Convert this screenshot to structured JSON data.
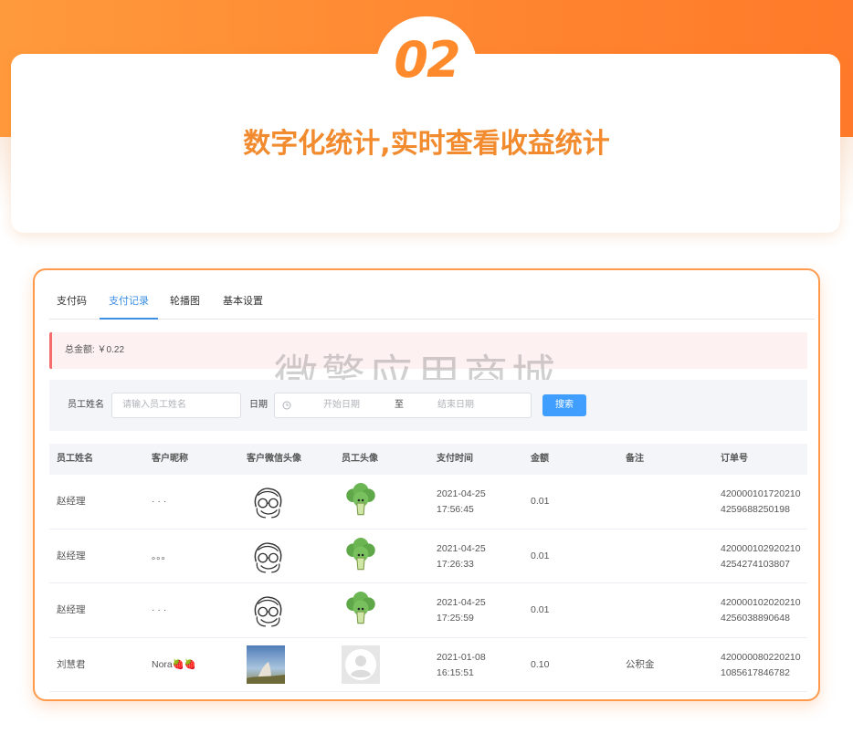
{
  "hero": {
    "badge_number": "02",
    "title": "数字化统计,实时查看收益统计"
  },
  "tabs": [
    {
      "label": "支付码",
      "active": false
    },
    {
      "label": "支付记录",
      "active": true
    },
    {
      "label": "轮播图",
      "active": false
    },
    {
      "label": "基本设置",
      "active": false
    }
  ],
  "summary": {
    "total_label": "总金额: ￥0.22"
  },
  "watermark": "微擎应用商城",
  "search": {
    "employee_label": "员工姓名",
    "employee_placeholder": "请输入员工姓名",
    "date_label": "日期",
    "start_placeholder": "开始日期",
    "range_separator": "至",
    "end_placeholder": "结束日期",
    "button_label": "搜索"
  },
  "table": {
    "headers": [
      "员工姓名",
      "客户昵称",
      "客户微信头像",
      "员工头像",
      "支付时间",
      "金额",
      "备注",
      "订单号"
    ],
    "rows": [
      {
        "employee": "赵经理",
        "nickname": "· · ·",
        "customer_avatar": "sketch-avatar-icon",
        "employee_avatar": "broccoli-icon",
        "time_date": "2021-04-25",
        "time_clock": "17:56:45",
        "amount": "0.01",
        "note": "",
        "order_1": "420000101720210",
        "order_2": "4259688250198"
      },
      {
        "employee": "赵经理",
        "nickname": "。。。",
        "customer_avatar": "sketch-avatar-icon",
        "employee_avatar": "broccoli-icon",
        "time_date": "2021-04-25",
        "time_clock": "17:26:33",
        "amount": "0.01",
        "note": "",
        "order_1": "420000102920210",
        "order_2": "4254274103807"
      },
      {
        "employee": "赵经理",
        "nickname": "· · ·",
        "customer_avatar": "sketch-avatar-icon",
        "employee_avatar": "broccoli-icon",
        "time_date": "2021-04-25",
        "time_clock": "17:25:59",
        "amount": "0.01",
        "note": "",
        "order_1": "420000102020210",
        "order_2": "4256038890648"
      },
      {
        "employee": "刘慧君",
        "nickname": "Nora🍓🍓",
        "customer_avatar": "photo-avatar",
        "employee_avatar": "default-avatar-icon",
        "time_date": "2021-01-08",
        "time_clock": "16:15:51",
        "amount": "0.10",
        "note": "公积金",
        "order_1": "420000080220210",
        "order_2": "1085617846782"
      }
    ]
  },
  "colors": {
    "brand_orange": "#ff8a2b",
    "active_tab": "#3b8fe5",
    "button": "#409eff",
    "alert_border": "#f56c6c"
  }
}
